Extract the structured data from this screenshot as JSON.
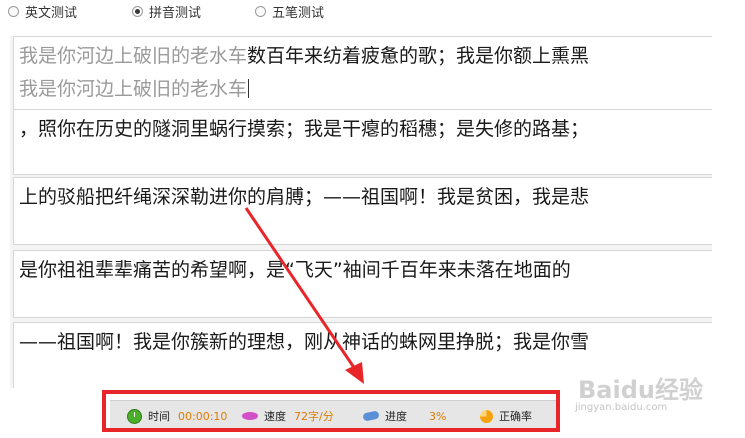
{
  "modes": [
    {
      "label": "英文测试",
      "selected": false
    },
    {
      "label": "拼音测试",
      "selected": true
    },
    {
      "label": "五笔测试",
      "selected": false
    }
  ],
  "lines": [
    {
      "reference_typed": "我是你河边上破旧的老水车",
      "reference_rest": "数百年来纺着疲惫的歌；我是你额上熏黑",
      "typed": "我是你河边上破旧的老水车"
    },
    {
      "reference": "，照你在历史的隧洞里蜗行摸索；我是干瘪的稻穗；是失修的路基；"
    },
    {
      "reference": "上的驳船把纤绳深深勒进你的肩膊；——祖国啊！我是贫困，我是悲"
    },
    {
      "reference": "是你祖祖辈辈痛苦的希望啊，是“飞天”袖间千百年来未落在地面的"
    },
    {
      "reference": "——祖国啊！我是你簇新的理想，刚从神话的蛛网里挣脱；我是你雪"
    }
  ],
  "status": {
    "time_label": "时间",
    "time_value": "00:00:10",
    "speed_label": "速度",
    "speed_value": "72字/分",
    "progress_label": "进度",
    "progress_value": "3%",
    "accuracy_label": "正确率"
  },
  "watermark": {
    "logo": "Baidu经验",
    "url": "jingyan.baidu.com"
  },
  "colors": {
    "highlight": "#e8262a",
    "value": "#e07b00"
  }
}
